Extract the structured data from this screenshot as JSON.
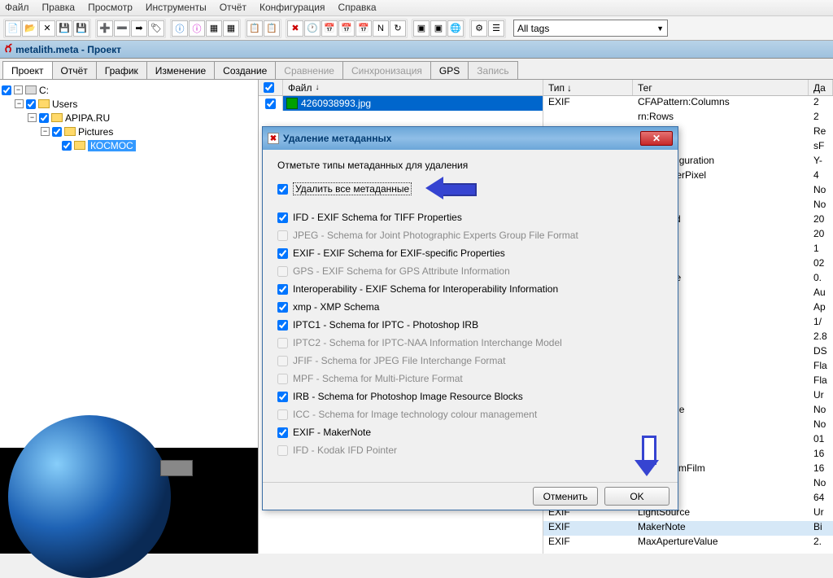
{
  "menu": [
    "Файл",
    "Правка",
    "Просмотр",
    "Инструменты",
    "Отчёт",
    "Конфигурация",
    "Справка"
  ],
  "tag_filter": "All tags",
  "doc_title": "metalith.meta - Проект",
  "tabs": [
    {
      "label": "Проект",
      "active": true
    },
    {
      "label": "Отчёт"
    },
    {
      "label": "График"
    },
    {
      "label": "Изменение"
    },
    {
      "label": "Создание"
    },
    {
      "label": "Сравнение",
      "disabled": true
    },
    {
      "label": "Синхронизация",
      "disabled": true
    },
    {
      "label": "GPS"
    },
    {
      "label": "Запись",
      "disabled": true
    }
  ],
  "tree": {
    "root": "C:",
    "n1": "Users",
    "n2": "APIPA.RU",
    "n3": "Pictures",
    "n4": "КОСМОС"
  },
  "file_col_header": "Файл",
  "file_name": "4260938993.jpg",
  "exif_headers": {
    "tip": "Тип",
    "ter": "Тег",
    "da": "Да"
  },
  "exif_rows": [
    {
      "tip": "EXIF",
      "ter": "CFAPattern:Columns",
      "da": "2"
    },
    {
      "tip": "",
      "ter": "rn:Rows",
      "da": "2"
    },
    {
      "tip": "",
      "ter": "rn:Values",
      "da": "Re"
    },
    {
      "tip": "",
      "ter": "ce",
      "da": "sF"
    },
    {
      "tip": "",
      "ter": "entsConfiguration",
      "da": "Y-"
    },
    {
      "tip": "",
      "ter": "sedBitsPerPixel",
      "da": "4"
    },
    {
      "tip": "",
      "ter": "",
      "da": "No"
    },
    {
      "tip": "",
      "ter": "endered",
      "da": "No"
    },
    {
      "tip": "",
      "ter": "eDigitized",
      "da": "20"
    },
    {
      "tip": "",
      "ter": "eOriginal",
      "da": "20"
    },
    {
      "tip": "",
      "ter": "omRatio",
      "da": "1"
    },
    {
      "tip": "",
      "ter": "n",
      "da": "02"
    },
    {
      "tip": "",
      "ter": "BiasValue",
      "da": "0."
    },
    {
      "tip": "",
      "ter": "Mode",
      "da": "Au"
    },
    {
      "tip": "",
      "ter": "Program",
      "da": "Ap"
    },
    {
      "tip": "",
      "ter": "Time",
      "da": "1/"
    },
    {
      "tip": "",
      "ter": "",
      "da": "2.8"
    },
    {
      "tip": "",
      "ter": "",
      "da": "DS"
    },
    {
      "tip": "",
      "ter": "d",
      "da": "Fla"
    },
    {
      "tip": "",
      "ter": "iction",
      "da": "Fla"
    },
    {
      "tip": "",
      "ter": "de",
      "da": "Ur"
    },
    {
      "tip": "",
      "ter": "dEyeMode",
      "da": "No"
    },
    {
      "tip": "",
      "ter": "turn",
      "da": "No"
    },
    {
      "tip": "",
      "ter": "ersion",
      "da": "01"
    },
    {
      "tip": "",
      "ter": "gth",
      "da": "16"
    },
    {
      "tip": "",
      "ter": "gthIn35mmFilm",
      "da": "16"
    },
    {
      "tip": "",
      "ter": "rol",
      "da": "No"
    },
    {
      "tip": "",
      "ter": "iqueID",
      "da": "64"
    },
    {
      "tip": "EXIF",
      "ter": "LightSource",
      "da": "Ur"
    },
    {
      "tip": "EXIF",
      "ter": "MakerNote",
      "da": "Bi",
      "sel": true
    },
    {
      "tip": "EXIF",
      "ter": "MaxApertureValue",
      "da": "2."
    }
  ],
  "modal": {
    "title": "Удаление метаданных",
    "instruction": "Отметьте типы метаданных для удаления",
    "delete_all": "Удалить все метаданные",
    "items": [
      {
        "label": "IFD - EXIF Schema for TIFF Properties",
        "checked": true
      },
      {
        "label": "JPEG - Schema for Joint Photographic Experts Group File Format",
        "disabled": true
      },
      {
        "label": "EXIF - EXIF Schema for EXIF-specific Properties",
        "checked": true
      },
      {
        "label": "GPS - EXIF Schema for GPS Attribute Information",
        "disabled": true
      },
      {
        "label": "Interoperability - EXIF Schema for Interoperability Information",
        "checked": true
      },
      {
        "label": "xmp - XMP Schema",
        "checked": true
      },
      {
        "label": "IPTC1 - Schema for IPTC - Photoshop IRB",
        "checked": true
      },
      {
        "label": "IPTC2 - Schema for IPTC-NAA Information Interchange Model",
        "disabled": true
      },
      {
        "label": "JFIF - Schema for JPEG File Interchange Format",
        "disabled": true
      },
      {
        "label": "MPF - Schema for Multi-Picture Format",
        "disabled": true
      },
      {
        "label": "IRB - Schema for Photoshop Image Resource Blocks",
        "checked": true
      },
      {
        "label": "ICC - Schema for Image technology colour management",
        "disabled": true
      },
      {
        "label": "EXIF - MakerNote",
        "checked": true
      },
      {
        "label": "IFD - Kodak IFD Pointer",
        "disabled": true
      }
    ],
    "cancel": "Отменить",
    "ok": "OK"
  }
}
